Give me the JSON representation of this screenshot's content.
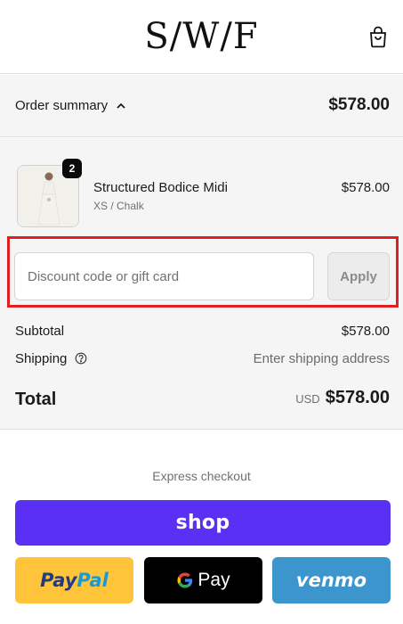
{
  "header": {
    "logo_text": "S/W/F",
    "cart_icon": "shopping-bag-icon"
  },
  "summary": {
    "toggle_label": "Order summary",
    "toggle_icon": "chevron-up-icon",
    "header_total": "$578.00"
  },
  "item": {
    "quantity": "2",
    "name": "Structured Bodice Midi",
    "variant": "XS / Chalk",
    "price": "$578.00"
  },
  "discount": {
    "placeholder": "Discount code or gift card",
    "value": "",
    "apply_label": "Apply"
  },
  "totals": {
    "subtotal_label": "Subtotal",
    "subtotal_value": "$578.00",
    "shipping_label": "Shipping",
    "shipping_value": "Enter shipping address",
    "total_label": "Total",
    "currency": "USD",
    "total_value": "$578.00"
  },
  "express": {
    "label": "Express checkout",
    "shop_label": "shop",
    "paypal_pay": "Pay",
    "paypal_pal": "Pal",
    "gpay_label": "Pay",
    "venmo_label": "venmo"
  },
  "colors": {
    "shop_purple": "#5a31f4",
    "paypal_yellow": "#ffc439",
    "venmo_blue": "#3d95ce",
    "highlight_red": "#e02020"
  }
}
